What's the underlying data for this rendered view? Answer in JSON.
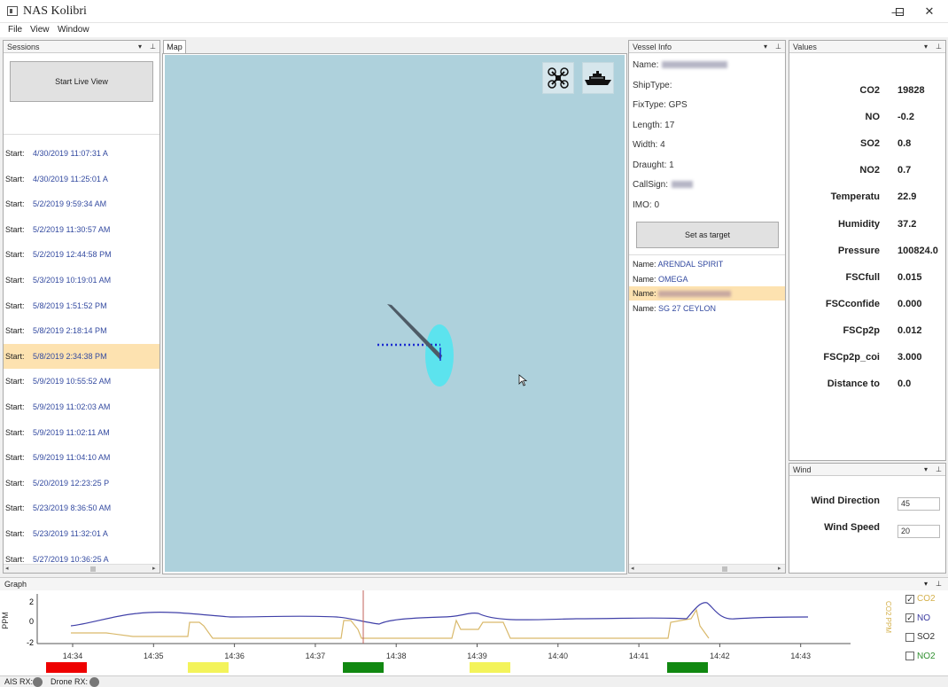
{
  "window": {
    "title": "NAS Kolibri",
    "minimize": "—",
    "maximize": "☐",
    "close": "✕"
  },
  "menu": [
    "File",
    "View",
    "Window"
  ],
  "sessions": {
    "header": "Sessions",
    "live_button": "Start Live View",
    "row_label": "Start:",
    "rows": [
      "4/30/2019 11:07:31 A",
      "4/30/2019 11:25:01 A",
      "5/2/2019 9:59:34 AM",
      "5/2/2019 11:30:57 AM",
      "5/2/2019 12:44:58 PM",
      "5/3/2019 10:19:01 AM",
      "5/8/2019 1:51:52 PM",
      "5/8/2019 2:18:14 PM",
      "5/8/2019 2:34:38 PM",
      "5/9/2019 10:55:52 AM",
      "5/9/2019 11:02:03 AM",
      "5/9/2019 11:02:11 AM",
      "5/9/2019 11:04:10 AM",
      "5/20/2019 12:23:25 P",
      "5/23/2019 8:36:50 AM",
      "5/23/2019 11:32:01 A",
      "5/27/2019 10:36:25 A"
    ],
    "selected_index": 8
  },
  "map": {
    "tab": "Map"
  },
  "vessel_info": {
    "header": "Vessel Info",
    "fields": {
      "name": "Name:",
      "shiptype": "ShipType:",
      "fixtype": "FixType: GPS",
      "length": "Length: 17",
      "width": "Width: 4",
      "draught": "Draught: 1",
      "callsign": "CallSign:",
      "imo": "IMO: 0"
    },
    "target_button": "Set as target",
    "list_label": "Name:",
    "vessels": [
      "ARENDAL SPIRIT",
      "OMEGA",
      "",
      "SG 27 CEYLON"
    ],
    "selected_index": 2
  },
  "values": {
    "header": "Values",
    "rows": [
      {
        "label": "CO2",
        "value": "19828"
      },
      {
        "label": "NO",
        "value": "-0.2"
      },
      {
        "label": "SO2",
        "value": "0.8"
      },
      {
        "label": "NO2",
        "value": "0.7"
      },
      {
        "label": "Temperatu",
        "value": "22.9"
      },
      {
        "label": "Humidity",
        "value": "37.2"
      },
      {
        "label": "Pressure",
        "value": "100824.0"
      },
      {
        "label": "FSCfull",
        "value": "0.015"
      },
      {
        "label": "FSCconfide",
        "value": "0.000"
      },
      {
        "label": "FSCp2p",
        "value": "0.012"
      },
      {
        "label": "FSCp2p_coi",
        "value": "3.000"
      },
      {
        "label": "Distance to",
        "value": "0.0"
      }
    ]
  },
  "wind": {
    "header": "Wind",
    "direction_label": "Wind Direction",
    "direction_value": "45",
    "speed_label": "Wind Speed",
    "speed_value": "20"
  },
  "graph": {
    "header": "Graph",
    "y_axis_label": "PPM",
    "y_ticks": [
      "2",
      "0",
      "-2"
    ],
    "x_ticks": [
      "14:34",
      "14:35",
      "14:36",
      "14:37",
      "14:38",
      "14:39",
      "14:40",
      "14:41",
      "14:42",
      "14:43"
    ],
    "secondary_axis_label": "CO2 PPM",
    "legend": [
      {
        "name": "CO2",
        "checked": true,
        "color": "#d4b04a"
      },
      {
        "name": "NO",
        "checked": true,
        "color": "#3b3ba0"
      },
      {
        "name": "SO2",
        "checked": false,
        "color": "#333333"
      },
      {
        "name": "NO2",
        "checked": false,
        "color": "#2f8f2f"
      }
    ]
  },
  "status": {
    "ais_label": "AIS RX:",
    "drone_label": "Drone RX:"
  },
  "colors": {
    "selection": "#fde2b0",
    "map_water": "#aed1dc",
    "link_text": "#334aa0"
  }
}
